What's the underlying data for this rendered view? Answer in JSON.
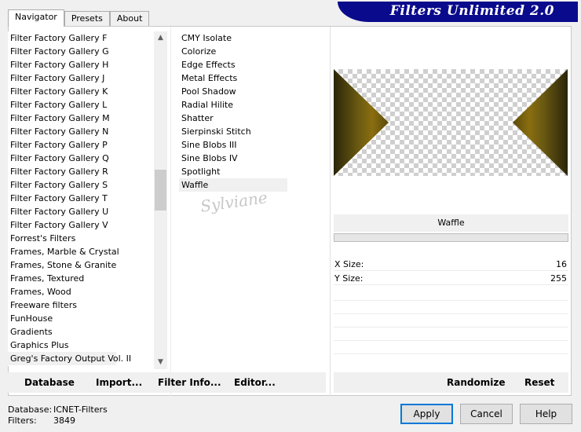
{
  "tabs": [
    "Navigator",
    "Presets",
    "About"
  ],
  "app_title": "Filters Unlimited 2.0",
  "categories": [
    "Filter Factory Gallery F",
    "Filter Factory Gallery G",
    "Filter Factory Gallery H",
    "Filter Factory Gallery J",
    "Filter Factory Gallery K",
    "Filter Factory Gallery L",
    "Filter Factory Gallery M",
    "Filter Factory Gallery N",
    "Filter Factory Gallery P",
    "Filter Factory Gallery Q",
    "Filter Factory Gallery R",
    "Filter Factory Gallery S",
    "Filter Factory Gallery T",
    "Filter Factory Gallery U",
    "Filter Factory Gallery V",
    "Forrest's Filters",
    "Frames, Marble & Crystal",
    "Frames, Stone & Granite",
    "Frames, Textured",
    "Frames, Wood",
    "Freeware filters",
    "FunHouse",
    "Gradients",
    "Graphics Plus",
    "Greg's Factory Output Vol. II"
  ],
  "selected_category": "Greg's Factory Output Vol. II",
  "filters": [
    "CMY Isolate",
    "Colorize",
    "Edge Effects",
    "Metal Effects",
    "Pool Shadow",
    "Radial Hilite",
    "Shatter",
    "Sierpinski Stitch",
    "Sine Blobs III",
    "Sine Blobs IV",
    "Spotlight",
    "Waffle"
  ],
  "selected_filter": "Waffle",
  "watermark": "Sylviane",
  "params": [
    {
      "label": "X Size:",
      "value": "16"
    },
    {
      "label": "Y Size:",
      "value": "255"
    }
  ],
  "bottom_links": {
    "database": "Database",
    "import": "Import...",
    "filter_info": "Filter Info...",
    "editor": "Editor...",
    "randomize": "Randomize",
    "reset": "Reset"
  },
  "status": {
    "database_label": "Database:",
    "database_value": "ICNET-Filters",
    "filters_label": "Filters:",
    "filters_value": "3849"
  },
  "buttons": {
    "apply": "Apply",
    "cancel": "Cancel",
    "help": "Help"
  },
  "icons": {
    "scroll_up": "chevron-up-icon",
    "scroll_down": "chevron-down-icon"
  },
  "colors": {
    "title_banner": "#0a0a8c"
  }
}
